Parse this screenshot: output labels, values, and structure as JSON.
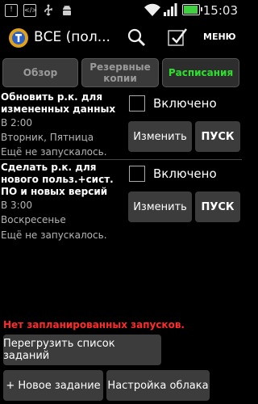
{
  "statusbar": {
    "icons": [
      "notification-icon",
      "code-icon",
      "usb-icon",
      "android-icon"
    ],
    "time": "15:03",
    "battery_level": 0.9
  },
  "actionbar": {
    "title": "ВСЕ (пол...",
    "menu_label": "МЕНЮ"
  },
  "tabs": [
    {
      "label": "Обзор",
      "active": false
    },
    {
      "label": "Резервные копии",
      "active": false
    },
    {
      "label": "Расписания",
      "active": true
    }
  ],
  "schedules": [
    {
      "title": "Обновить р.к. для измененных данных",
      "time": "В 2:00",
      "days": "Вторник, Пятница",
      "status": "Ещё не запускалось.",
      "enabled_label": "Включено",
      "enabled": false,
      "edit_label": "Изменить",
      "run_label": "ПУСК"
    },
    {
      "title": "Сделать р.к. для нового польз.+сист. ПО и новых версий",
      "time": "В 3:00",
      "days": "Воскресенье",
      "status": "Ещё не запускалось.",
      "enabled_label": "Включено",
      "enabled": false,
      "edit_label": "Изменить",
      "run_label": "ПУСК"
    }
  ],
  "no_runs_text": "Нет запланированных запусков.",
  "buttons": {
    "reload": "Перегрузить список заданий",
    "new_task": "+ Новое задание",
    "cloud": "Настройка облака"
  },
  "colors": {
    "active_tab": "#2ee02e",
    "warning": "#ff2b2b"
  }
}
